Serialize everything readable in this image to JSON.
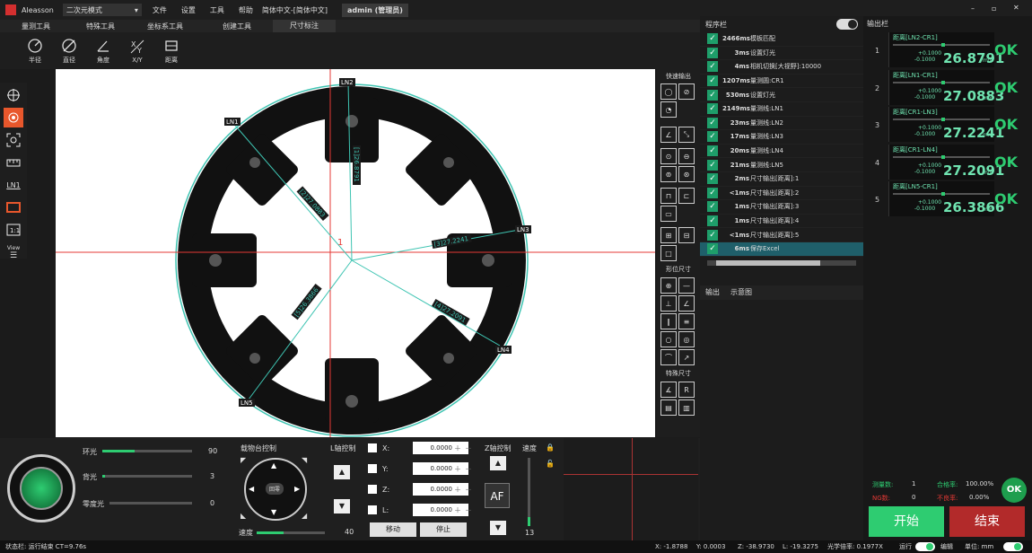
{
  "app": {
    "name": "Aleasson",
    "mode": "二次元模式",
    "menu": [
      "文件",
      "设置",
      "工具",
      "帮助",
      "简体中文-[简体中文]"
    ],
    "user": "admin (管理员)"
  },
  "tabs": [
    "量测工具",
    "特殊工具",
    "坐标系工具",
    "创建工具",
    "尺寸标注"
  ],
  "toolbar": [
    {
      "icon": "radius-icon",
      "label": "半径"
    },
    {
      "icon": "diameter-icon",
      "label": "直径"
    },
    {
      "icon": "angle-icon",
      "label": "角度"
    },
    {
      "icon": "xy-icon",
      "label": "X/Y"
    },
    {
      "icon": "distance-icon",
      "label": "距离"
    }
  ],
  "left_tools": [
    "crosshair-icon",
    "target-icon",
    "focus-icon",
    "ruler-icon",
    "line-icon",
    "box-icon",
    "scale-icon",
    "view-icon"
  ],
  "left_view_label": "View",
  "palette": {
    "quick_output": "快速输出",
    "form_tol": "形位尺寸",
    "special": "特殊尺寸"
  },
  "canvas_labels": {
    "ln1": "LN1",
    "ln2": "LN2",
    "ln3": "LN3",
    "ln4": "LN4",
    "ln5": "LN5",
    "cr1": "1",
    "m1": "[1]26.8791",
    "m2": "[2]27.0883",
    "m3": "[3]27.2241",
    "m4": "[4]27.2091",
    "m5": "[5]26.3866"
  },
  "light": {
    "ring": "环光",
    "ring_val": "90",
    "back": "背光",
    "back_val": "3",
    "coax": "零度光",
    "coax_val": "0"
  },
  "stage": {
    "title": "载物台控制",
    "center": "回零",
    "speed_label": "速度",
    "speed_val": "40"
  },
  "l_axis": {
    "title": "L轴控制"
  },
  "coords": [
    {
      "axis": "X:",
      "value": "0.0000"
    },
    {
      "axis": "Y:",
      "value": "0.0000"
    },
    {
      "axis": "Z:",
      "value": "0.0000"
    },
    {
      "axis": "L:",
      "value": "0.0000"
    }
  ],
  "move_label": "移动",
  "stop_label": "停止",
  "z_axis": {
    "title": "Z轴控制",
    "af": "AF",
    "speed": "速度",
    "speed_val": "13"
  },
  "program": {
    "title": "程序栏",
    "items": [
      {
        "ms": "2466ms",
        "name": "模板匹配"
      },
      {
        "ms": "3ms",
        "name": "设置灯光"
      },
      {
        "ms": "4ms",
        "name": "相机切换[大视野]:10000"
      },
      {
        "ms": "1207ms",
        "name": "量测圆:CR1"
      },
      {
        "ms": "530ms",
        "name": "设置灯光"
      },
      {
        "ms": "2149ms",
        "name": "量测线:LN1"
      },
      {
        "ms": "23ms",
        "name": "量测线:LN2"
      },
      {
        "ms": "17ms",
        "name": "量测线:LN3"
      },
      {
        "ms": "20ms",
        "name": "量测线:LN4"
      },
      {
        "ms": "21ms",
        "name": "量测线:LN5"
      },
      {
        "ms": "2ms",
        "name": "尺寸输出[距离]:1"
      },
      {
        "ms": "<1ms",
        "name": "尺寸输出[距离]:2"
      },
      {
        "ms": "1ms",
        "name": "尺寸输出[距离]:3"
      },
      {
        "ms": "1ms",
        "name": "尺寸输出[距离]:4"
      },
      {
        "ms": "<1ms",
        "name": "尺寸输出[距离]:5"
      },
      {
        "ms": "6ms",
        "name": "保存Excel"
      }
    ],
    "tab_output": "输出",
    "tab_diagram": "示意图"
  },
  "output": {
    "title": "输出栏",
    "items": [
      {
        "idx": "1",
        "name": "距离[LN2-CR1]",
        "tol_hi": "+0.1000",
        "tol_lo": "-0.1000",
        "value": "26.8791",
        "unit": "mm",
        "result": "OK"
      },
      {
        "idx": "2",
        "name": "距离[LN1-CR1]",
        "tol_hi": "+0.1000",
        "tol_lo": "-0.1000",
        "value": "27.0883",
        "unit": "mm",
        "result": "OK"
      },
      {
        "idx": "3",
        "name": "距离[CR1-LN3]",
        "tol_hi": "+0.1000",
        "tol_lo": "-0.1000",
        "value": "27.2241",
        "unit": "mm",
        "result": "OK"
      },
      {
        "idx": "4",
        "name": "距离[CR1-LN4]",
        "tol_hi": "+0.1000",
        "tol_lo": "-0.1000",
        "value": "27.2091",
        "unit": "mm",
        "result": "OK"
      },
      {
        "idx": "5",
        "name": "距离[LN5-CR1]",
        "tol_hi": "+0.1000",
        "tol_lo": "-0.1000",
        "value": "26.3866",
        "unit": "mm",
        "result": "OK"
      }
    ]
  },
  "stats": {
    "count_label": "测量数:",
    "count": "1",
    "pass_label": "合格率:",
    "pass": "100.00%",
    "ng_label": "NG数:",
    "ng": "0",
    "fail_label": "不良率:",
    "fail": "0.00%",
    "overall": "OK"
  },
  "actions": {
    "start": "开始",
    "end": "结束"
  },
  "status": {
    "left": "状态栏: 运行结束 CT=9.76s",
    "x": "X: -1.8788",
    "y": "Y: 0.0003",
    "z": "Z: -38.9730",
    "l": "L: -19.3275",
    "mag": "光学倍率: 0.1977X",
    "run": "运行",
    "edit": "编辑",
    "unit": "单位: mm"
  },
  "colors": {
    "accent": "#2ecc71",
    "teal": "#1e9e6a",
    "red": "#c0392b",
    "cyan": "#3ec4b2"
  }
}
